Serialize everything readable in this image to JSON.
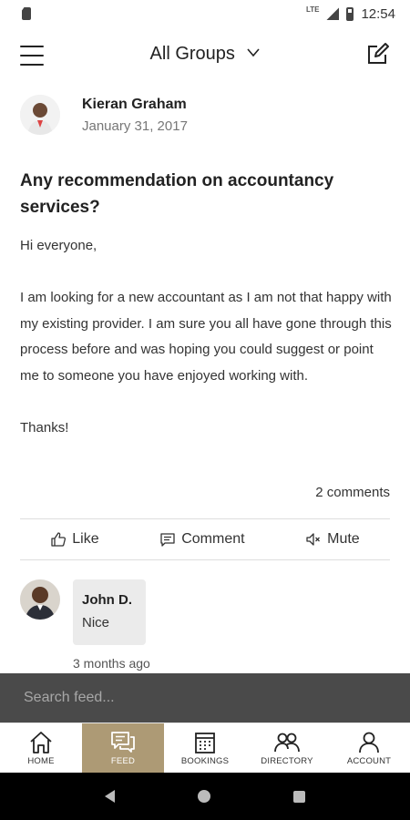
{
  "status_bar": {
    "time": "12:54",
    "network": "LTE"
  },
  "header": {
    "title": "All Groups"
  },
  "post": {
    "author": "Kieran Graham",
    "date": "January 31, 2017",
    "title": "Any recommendation on accountancy services?",
    "body": {
      "greeting": "Hi everyone,",
      "paragraph": "I am looking for a new accountant as I am not that happy with my existing provider. I am sure you all have gone through this process before and was hoping you could suggest or point me to someone you have enjoyed working with.",
      "signoff": "Thanks!"
    },
    "comments_count": "2 comments"
  },
  "actions": {
    "like_label": "Like",
    "comment_label": "Comment",
    "mute_label": "Mute"
  },
  "comment": {
    "author": "John D.",
    "text": "Nice",
    "time": "3 months ago"
  },
  "search": {
    "placeholder": "Search feed..."
  },
  "bottom_nav": {
    "home": "HOME",
    "feed": "FEED",
    "bookings": "BOOKINGS",
    "directory": "DIRECTORY",
    "account": "ACCOUNT"
  },
  "colors": {
    "accent": "#ad9a75",
    "search_bg": "#4a4a4a",
    "bubble_bg": "#ebebeb"
  }
}
